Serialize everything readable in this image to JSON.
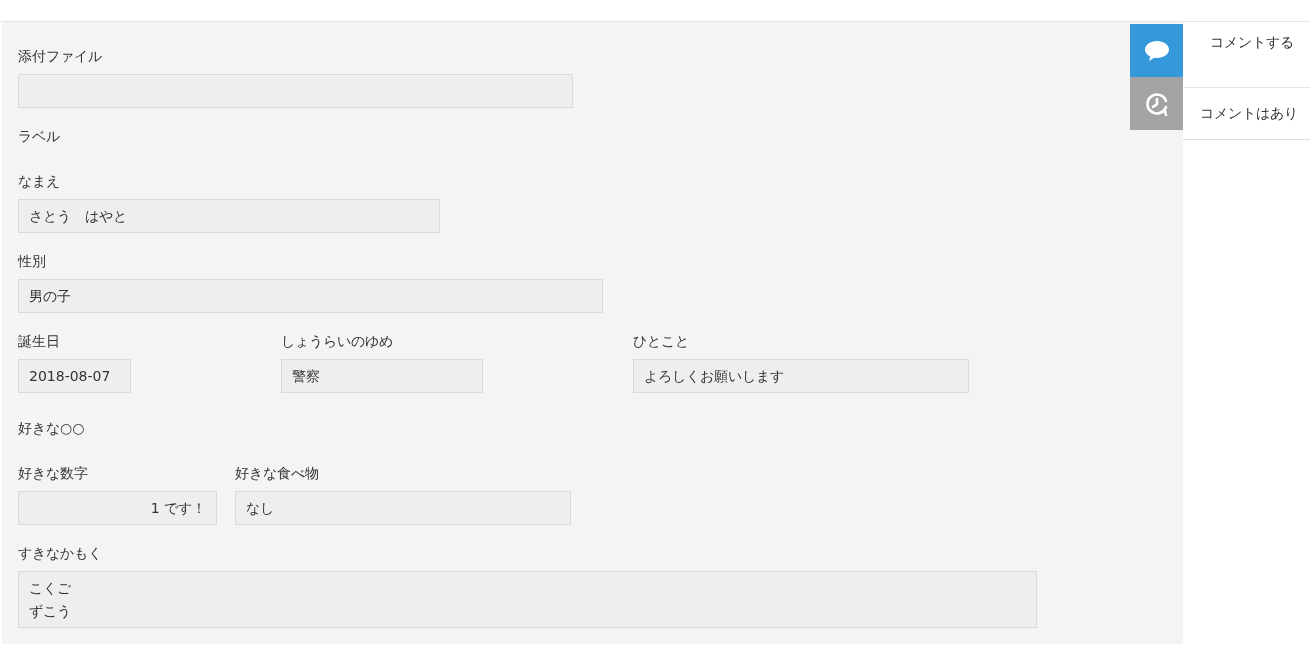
{
  "form": {
    "rows": [
      {
        "kind": "field",
        "fields": [
          {
            "label": "添付ファイル",
            "kind": "text"
          }
        ]
      },
      {
        "kind": "label",
        "text": "ラベル"
      },
      {
        "kind": "field",
        "fields": [
          {
            "label": "なまえ",
            "kind": "text",
            "value": "さとう　はやと"
          }
        ]
      },
      {
        "kind": "field",
        "fields": [
          {
            "label": "性別",
            "kind": "text",
            "value": "男の子"
          }
        ]
      },
      {
        "kind": "field",
        "fields": [
          {
            "label": "誕生日",
            "kind": "text",
            "value": "2018-08-07"
          },
          {
            "label": "しょうらいのゆめ",
            "kind": "text",
            "value": "警察"
          },
          {
            "label": "ひとこと",
            "kind": "text",
            "value": "よろしくお願いします"
          }
        ]
      },
      {
        "kind": "label",
        "text": "好きな○○"
      },
      {
        "kind": "field",
        "fields": [
          {
            "label": "好きな数字",
            "kind": "number",
            "value": "1 です！"
          },
          {
            "label": "好きな食べ物",
            "kind": "text",
            "value": "なし"
          }
        ]
      },
      {
        "kind": "field",
        "fields": [
          {
            "label": "すきなかもく",
            "kind": "multiline",
            "lines": [
              "こくご",
              "ずこう"
            ]
          }
        ]
      }
    ]
  },
  "side_tabs": [
    {
      "kind": "comment",
      "selected": true
    },
    {
      "kind": "history",
      "selected": false
    }
  ],
  "comment_panel": {
    "action": "コメントする",
    "empty_message": "コメントはあり"
  }
}
